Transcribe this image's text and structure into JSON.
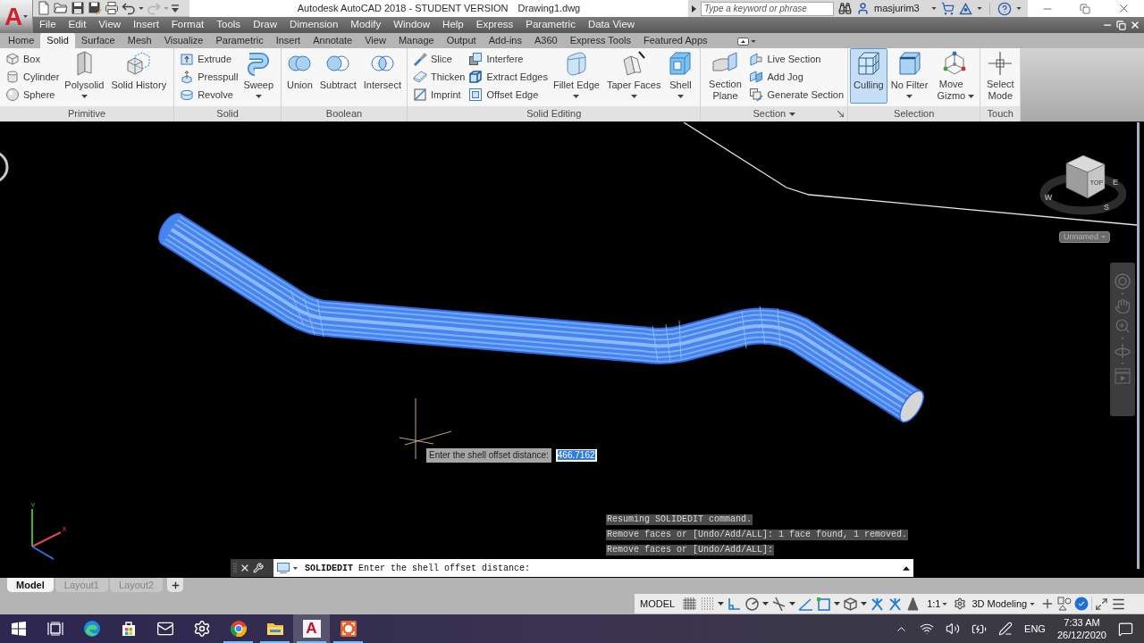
{
  "window": {
    "title": "Autodesk AutoCAD 2018 - STUDENT VERSION",
    "document": "Drawing1.dwg"
  },
  "app_button": {
    "label": "A"
  },
  "search": {
    "placeholder": "Type a keyword or phrase"
  },
  "user": {
    "name": "masjurim3"
  },
  "menu": [
    "File",
    "Edit",
    "View",
    "Insert",
    "Format",
    "Tools",
    "Draw",
    "Dimension",
    "Modify",
    "Window",
    "Help",
    "Express",
    "Parametric",
    "Data View"
  ],
  "ribbon_tabs": [
    {
      "label": "Home",
      "selected": false
    },
    {
      "label": "Solid",
      "selected": true
    },
    {
      "label": "Surface",
      "selected": false
    },
    {
      "label": "Mesh",
      "selected": false
    },
    {
      "label": "Visualize",
      "selected": false
    },
    {
      "label": "Parametric",
      "selected": false
    },
    {
      "label": "Insert",
      "selected": false
    },
    {
      "label": "Annotate",
      "selected": false
    },
    {
      "label": "View",
      "selected": false
    },
    {
      "label": "Manage",
      "selected": false
    },
    {
      "label": "Output",
      "selected": false
    },
    {
      "label": "Add-ins",
      "selected": false
    },
    {
      "label": "A360",
      "selected": false
    },
    {
      "label": "Express Tools",
      "selected": false
    },
    {
      "label": "Featured Apps",
      "selected": false
    }
  ],
  "ribbon_panels": [
    {
      "title": "Primitive",
      "dropdown": false,
      "launcher": false,
      "groups": [
        {
          "kind": "stack",
          "tools": [
            {
              "label": "Box"
            },
            {
              "label": "Cylinder"
            },
            {
              "label": "Sphere"
            }
          ]
        },
        {
          "kind": "large",
          "label": "Polysolid",
          "dropdown": true,
          "selected": false
        },
        {
          "kind": "large",
          "label": "Solid History",
          "dropdown": false,
          "selected": false
        }
      ]
    },
    {
      "title": "Solid",
      "dropdown": false,
      "launcher": false,
      "groups": [
        {
          "kind": "stack",
          "tools": [
            {
              "label": "Extrude"
            },
            {
              "label": "Presspull"
            },
            {
              "label": "Revolve"
            }
          ]
        },
        {
          "kind": "large",
          "label": "Sweep",
          "dropdown": true,
          "selected": false
        }
      ]
    },
    {
      "title": "Boolean",
      "dropdown": false,
      "launcher": false,
      "groups": [
        {
          "kind": "large",
          "label": "Union",
          "dropdown": false,
          "selected": false
        },
        {
          "kind": "large",
          "label": "Subtract",
          "dropdown": false,
          "selected": false
        },
        {
          "kind": "large",
          "label": "Intersect",
          "dropdown": false,
          "selected": false
        }
      ]
    },
    {
      "title": "Solid Editing",
      "dropdown": false,
      "launcher": false,
      "groups": [
        {
          "kind": "stack",
          "tools": [
            {
              "label": "Slice"
            },
            {
              "label": "Thicken"
            },
            {
              "label": "Imprint"
            }
          ]
        },
        {
          "kind": "stack",
          "tools": [
            {
              "label": "Interfere"
            },
            {
              "label": "Extract Edges"
            },
            {
              "label": "Offset Edge"
            }
          ]
        },
        {
          "kind": "large",
          "label": "Fillet Edge",
          "dropdown": true,
          "selected": false
        },
        {
          "kind": "large",
          "label": "Taper Faces",
          "dropdown": true,
          "selected": false
        },
        {
          "kind": "large",
          "label": "Shell",
          "dropdown": true,
          "selected": false
        }
      ]
    },
    {
      "title": "Section",
      "dropdown": true,
      "launcher": true,
      "groups": [
        {
          "kind": "large",
          "label": "Section Plane",
          "dropdown": false,
          "selected": false
        },
        {
          "kind": "stack",
          "tools": [
            {
              "label": "Live Section"
            },
            {
              "label": "Add Jog"
            },
            {
              "label": "Generate Section"
            }
          ]
        }
      ]
    },
    {
      "title": "Selection",
      "dropdown": false,
      "launcher": false,
      "groups": [
        {
          "kind": "large",
          "label": "Culling",
          "dropdown": false,
          "selected": true
        },
        {
          "kind": "large",
          "label": "No Filter",
          "dropdown": true,
          "selected": false
        },
        {
          "kind": "large",
          "label": "Move Gizmo",
          "dropdown": true,
          "selected": false
        }
      ]
    },
    {
      "title": "Touch",
      "dropdown": false,
      "launcher": false,
      "groups": [
        {
          "kind": "large",
          "label": "Select Mode",
          "dropdown": false,
          "selected": false
        }
      ]
    }
  ],
  "viewport": {
    "viewcube": {
      "face": "TOP",
      "compass": [
        "W",
        "S",
        "E"
      ]
    },
    "visual_style": "Unnamed",
    "dynamic_input": {
      "prompt": "Enter the shell offset distance:",
      "value": "466.7162",
      "selected": true
    },
    "history": [
      "Resuming SOLIDEDIT command.",
      "Remove faces or [Undo/Add/ALL]: 1 face found, 1 removed.",
      "Remove faces or [Undo/Add/ALL]:"
    ],
    "ucs": {
      "x": "X",
      "y": "Y"
    }
  },
  "command_line": {
    "command": "SOLIDEDIT",
    "prompt": "Enter the shell offset distance:"
  },
  "layout_tabs": [
    {
      "label": "Model",
      "selected": true
    },
    {
      "label": "Layout1",
      "selected": false
    },
    {
      "label": "Layout2",
      "selected": false
    }
  ],
  "status_bar": {
    "model": "MODEL",
    "toggles": [
      {
        "on": false
      },
      {
        "on": false
      },
      {
        "on": true
      },
      {
        "on": false
      },
      {
        "on": false
      },
      {
        "on": true
      },
      {
        "on": true
      },
      {
        "on": false
      },
      {
        "on": true
      },
      {
        "on": true
      },
      {
        "on": false
      }
    ],
    "scale": "1:1",
    "workspace": "3D Modeling",
    "graphics_performance": {
      "on": true
    }
  },
  "taskbar": {
    "apps": [
      {
        "running": false,
        "active": false
      },
      {
        "running": false,
        "active": false
      },
      {
        "running": false,
        "active": false
      },
      {
        "running": false,
        "active": false
      },
      {
        "running": true,
        "active": false
      },
      {
        "running": true,
        "active": false
      },
      {
        "label": "A",
        "running": true,
        "active": true
      },
      {
        "running": true,
        "active": false
      }
    ],
    "language": "ENG",
    "time": "7:33 AM",
    "date": "26/12/2020"
  }
}
